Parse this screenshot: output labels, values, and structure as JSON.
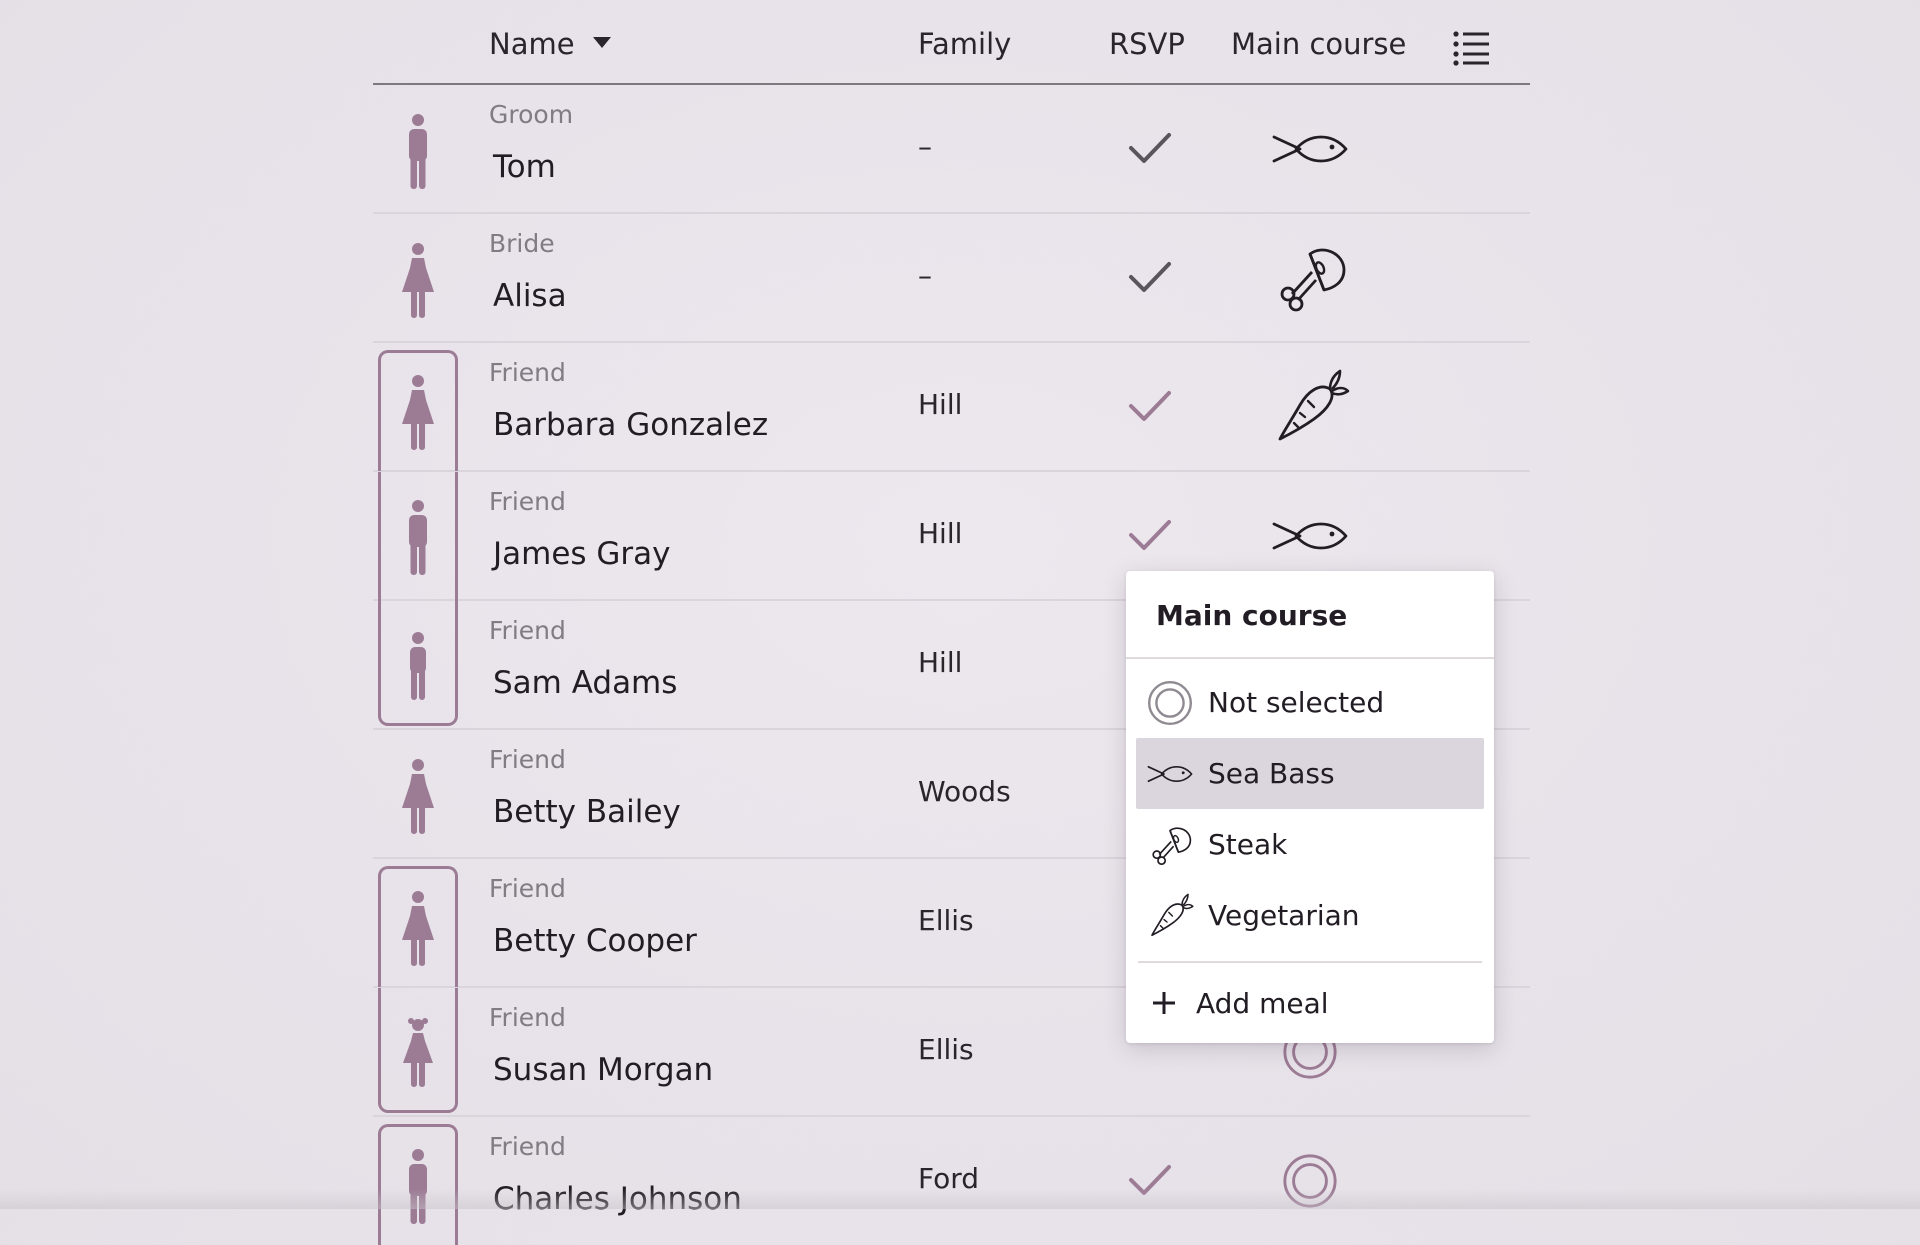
{
  "header": {
    "name_label": "Name",
    "family_label": "Family",
    "rsvp_label": "RSVP",
    "main_course_label": "Main course"
  },
  "guests": [
    {
      "role": "Groom",
      "name": "Tom",
      "family": "–",
      "rsvp": "confirmed",
      "meal": "fish",
      "figure": "man"
    },
    {
      "role": "Bride",
      "name": "Alisa",
      "family": "–",
      "rsvp": "confirmed",
      "meal": "steak",
      "figure": "woman"
    },
    {
      "role": "Friend",
      "name": "Barbara Gonzalez",
      "family": "Hill",
      "rsvp": "accepted",
      "meal": "vegetarian",
      "figure": "woman"
    },
    {
      "role": "Friend",
      "name": "James Gray",
      "family": "Hill",
      "rsvp": "accepted",
      "meal": "fish",
      "figure": "man"
    },
    {
      "role": "Friend",
      "name": "Sam Adams",
      "family": "Hill",
      "rsvp": "",
      "meal": "",
      "figure": "boy"
    },
    {
      "role": "Friend",
      "name": "Betty Bailey",
      "family": "Woods",
      "rsvp": "",
      "meal": "",
      "figure": "woman"
    },
    {
      "role": "Friend",
      "name": "Betty Cooper",
      "family": "Ellis",
      "rsvp": "",
      "meal": "",
      "figure": "woman"
    },
    {
      "role": "Friend",
      "name": "Susan Morgan",
      "family": "Ellis",
      "rsvp": "",
      "meal": "not-selected",
      "figure": "girl"
    },
    {
      "role": "Friend",
      "name": "Charles Johnson",
      "family": "Ford",
      "rsvp": "accepted",
      "meal": "not-selected",
      "figure": "man"
    }
  ],
  "meal_popup": {
    "title": "Main course",
    "options": [
      {
        "label": "Not selected",
        "icon": "not-selected-icon"
      },
      {
        "label": "Sea Bass",
        "icon": "fish-icon",
        "highlighted": true
      },
      {
        "label": "Steak",
        "icon": "steak-icon"
      },
      {
        "label": "Vegetarian",
        "icon": "carrot-icon"
      }
    ],
    "add_label": "Add meal"
  },
  "colors": {
    "accent": "#9c7c95",
    "check_dark": "#5a555c",
    "text": "#221d24",
    "muted": "#827b84"
  }
}
